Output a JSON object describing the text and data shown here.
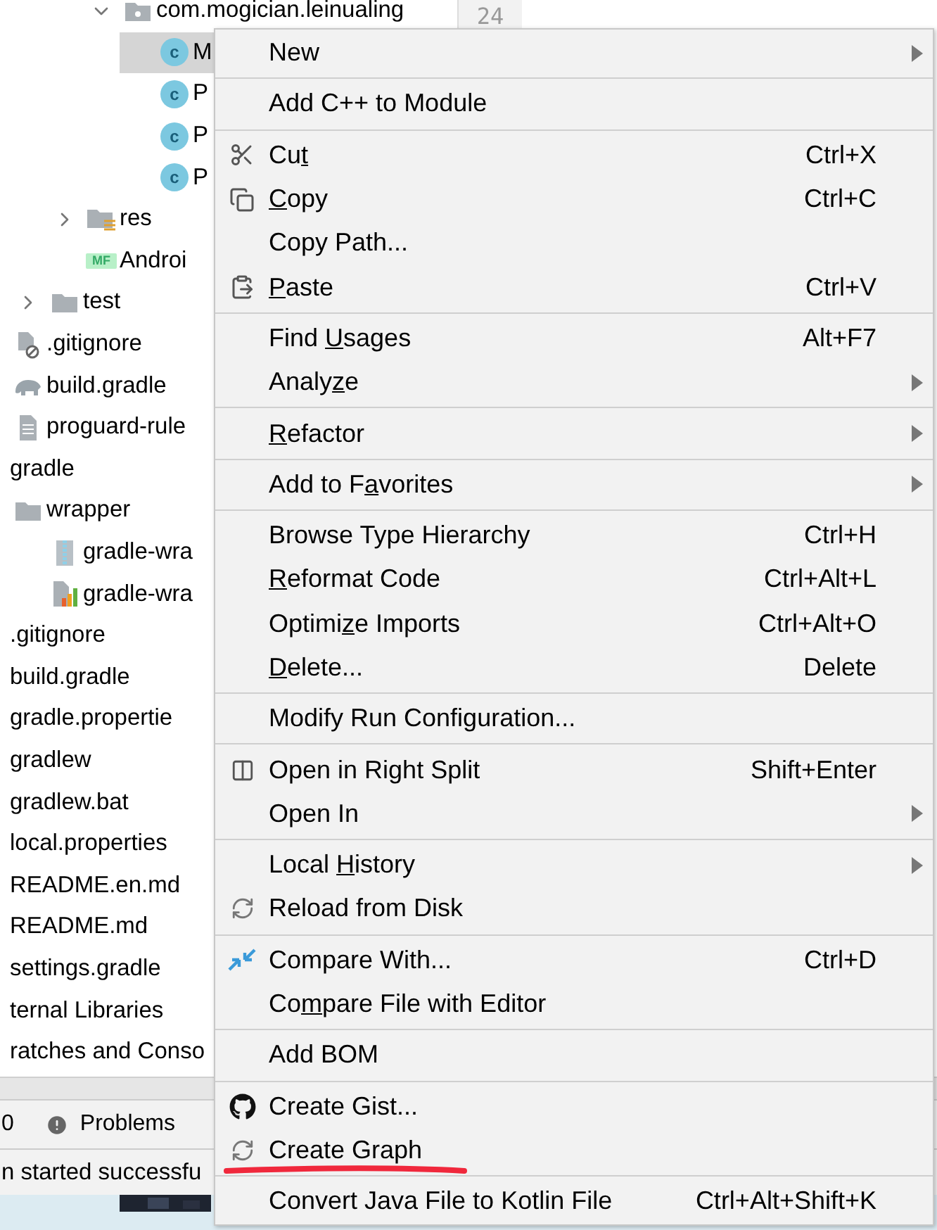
{
  "project_tree": [
    {
      "children": [
        {
          "children": [
            {
              "children": [
                {
                  "children": [
                    {
                      "label": "com.mogician.leinualing",
                      "kind": "package",
                      "expanded": true,
                      "selected": false,
                      "children": [
                        {
                          "label": "M",
                          "kind": "class",
                          "badge": "c",
                          "selected": true
                        },
                        {
                          "label": "P",
                          "kind": "class",
                          "badge": "c",
                          "selected": false
                        },
                        {
                          "label": "P",
                          "kind": "class",
                          "badge": "c",
                          "selected": false
                        },
                        {
                          "label": "P",
                          "kind": "class",
                          "badge": "c",
                          "selected": false
                        }
                      ]
                    }
                  ]
                },
                {
                  "label": "res",
                  "kind": "res-folder",
                  "expanded": false,
                  "selected": false
                },
                {
                  "label": "Androi",
                  "kind": "manifest",
                  "badge": "MF",
                  "selected": false
                }
              ]
            },
            {
              "label": "test",
              "kind": "folder",
              "expanded": false,
              "selected": false
            }
          ]
        },
        {
          "label": ".gitignore",
          "kind": "ignore-file",
          "selected": false
        },
        {
          "label": "build.gradle",
          "kind": "gradle",
          "selected": false
        },
        {
          "label": "proguard-rule",
          "kind": "text-file",
          "selected": false
        }
      ]
    },
    {
      "label": "gradle",
      "selected": false,
      "children": [
        {
          "label": "wrapper",
          "kind": "folder",
          "selected": false,
          "children": [
            {
              "label": "gradle-wra",
              "kind": "archive",
              "selected": false
            },
            {
              "label": "gradle-wra",
              "kind": "properties",
              "selected": false
            }
          ]
        }
      ]
    },
    {
      "label": ".gitignore",
      "selected": false
    },
    {
      "label": "build.gradle",
      "selected": false
    },
    {
      "label": "gradle.propertie",
      "selected": false
    },
    {
      "label": "gradlew",
      "selected": false
    },
    {
      "label": "gradlew.bat",
      "selected": false
    },
    {
      "label": "local.properties",
      "selected": false
    },
    {
      "label": "README.en.md",
      "selected": false
    },
    {
      "label": "README.md",
      "selected": false
    },
    {
      "label": "settings.gradle",
      "selected": false
    },
    {
      "label": "ternal Libraries",
      "selected": false
    },
    {
      "label": "ratches and Conso",
      "selected": false
    }
  ],
  "editor": {
    "line_number": "24"
  },
  "tool_tabs": [
    {
      "label": "0"
    },
    {
      "label": "Problems",
      "kind": "alert"
    }
  ],
  "status_bar": {
    "text": "n started successfu"
  },
  "context_menu": [
    [
      {
        "label": "New",
        "submenu": true
      }
    ],
    [
      {
        "label": "Add C++ to Module",
        "submenu": false
      }
    ],
    [
      {
        "label": {
          "pre": "Cu",
          "key": "t"
        },
        "kind": "scissors",
        "shortcut": "Ctrl+X",
        "submenu": false
      },
      {
        "label": {
          "key": "C",
          "post": "opy"
        },
        "kind": "copy",
        "shortcut": "Ctrl+C",
        "submenu": false
      },
      {
        "label": "Copy Path...",
        "submenu": false
      },
      {
        "label": {
          "key": "P",
          "post": "aste"
        },
        "kind": "paste",
        "shortcut": "Ctrl+V",
        "submenu": false
      }
    ],
    [
      {
        "label": {
          "pre": "Find ",
          "key": "U",
          "post": "sages"
        },
        "shortcut": "Alt+F7",
        "submenu": false
      },
      {
        "label": {
          "pre": "Analy",
          "key": "z",
          "post": "e"
        },
        "submenu": true
      }
    ],
    [
      {
        "label": {
          "key": "R",
          "post": "efactor"
        },
        "submenu": true
      }
    ],
    [
      {
        "label": {
          "pre": "Add to F",
          "key": "a",
          "post": "vorites"
        },
        "submenu": true
      }
    ],
    [
      {
        "label": "Browse Type Hierarchy",
        "shortcut": "Ctrl+H",
        "submenu": false
      },
      {
        "label": {
          "key": "R",
          "post": "eformat Code"
        },
        "shortcut": "Ctrl+Alt+L",
        "submenu": false
      },
      {
        "label": {
          "pre": "Optimi",
          "key": "z",
          "post": "e Imports"
        },
        "shortcut": "Ctrl+Alt+O",
        "submenu": false
      },
      {
        "label": {
          "key": "D",
          "post": "elete..."
        },
        "shortcut": "Delete",
        "submenu": false
      }
    ],
    [
      {
        "label": "Modify Run Configuration...",
        "submenu": false
      }
    ],
    [
      {
        "label": "Open in Right Split",
        "kind": "split",
        "shortcut": "Shift+Enter",
        "submenu": false
      },
      {
        "label": "Open In",
        "submenu": true
      }
    ],
    [
      {
        "label": {
          "pre": "Local ",
          "key": "H",
          "post": "istory"
        },
        "submenu": true
      },
      {
        "label": "Reload from Disk",
        "kind": "reload",
        "submenu": false
      }
    ],
    [
      {
        "label": "Compare With...",
        "kind": "compare",
        "shortcut": "Ctrl+D",
        "submenu": false
      },
      {
        "label": {
          "pre": "Co",
          "key": "m",
          "post": "pare File with Editor"
        },
        "submenu": false
      }
    ],
    [
      {
        "label": "Add BOM",
        "submenu": false
      }
    ],
    [
      {
        "label": "Create Gist...",
        "kind": "github",
        "submenu": false
      },
      {
        "label": "Create Graph",
        "kind": "reload",
        "submenu": false
      }
    ],
    [
      {
        "label": "Convert Java File to Kotlin File",
        "shortcut": "Ctrl+Alt+Shift+K",
        "submenu": false
      }
    ]
  ]
}
